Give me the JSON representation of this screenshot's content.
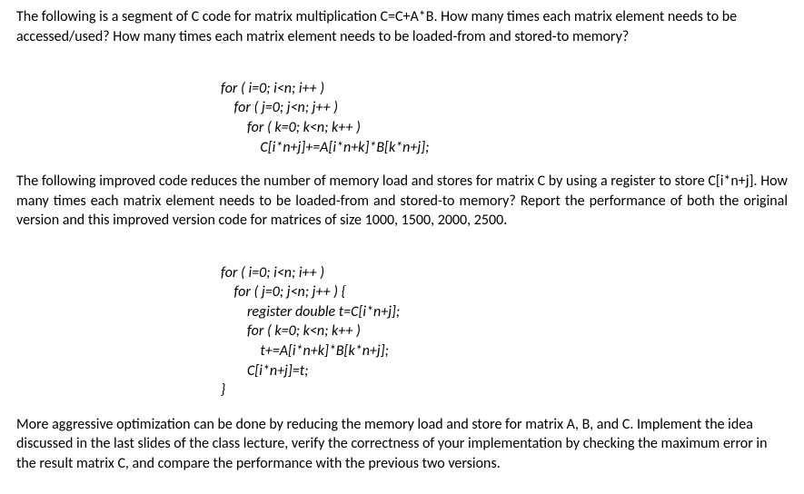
{
  "paragraphs": {
    "p1": "The following is a segment of C code for matrix multiplication C=C+A*B. How many times each matrix element needs to be accessed/used? How many times each matrix element needs to be loaded-from and stored-to memory?",
    "p2": "The following improved code reduces the number of memory load and stores for matrix C by using a register to store C[i*n+j]. How many times each matrix element needs to be loaded-from and stored-to memory? Report the performance of both the original version and this improved version code for matrices of size 1000, 1500, 2000, 2500.",
    "p3": "More aggressive optimization can be done by reducing the memory load and store for matrix A, B, and C. Implement the idea discussed in the last slides of the class lecture, verify the correctness of your implementation by checking the maximum error in the result matrix C, and compare the performance with the previous two versions."
  },
  "code1": {
    "l1": "for ( i=0; i<n; i++ )",
    "l2": "    for ( j=0; j<n; j++ )",
    "l3": "        for ( k=0; k<n; k++ )",
    "l4": "            C[i*n+j]+=A[i*n+k]*B[k*n+j];"
  },
  "code2": {
    "l1": "for ( i=0; i<n; i++ )",
    "l2": "    for ( j=0; j<n; j++ ) {",
    "l3": "        register double t=C[i*n+j];",
    "l4": "        for ( k=0; k<n; k++ )",
    "l5": "            t+=A[i*n+k]*B[k*n+j];",
    "l6": "        C[i*n+j]=t;",
    "l7": "}"
  }
}
